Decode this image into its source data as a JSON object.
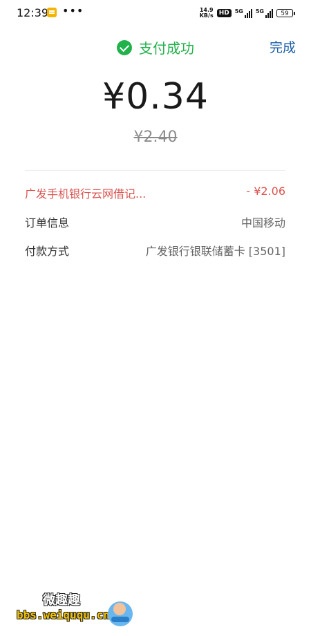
{
  "status_bar": {
    "time": "12:39",
    "dots": "•••",
    "net_speed_value": "14.9",
    "net_speed_unit": "KB/s",
    "hd": "HD",
    "sig1": "5G",
    "sig2": "5G",
    "battery": "59"
  },
  "header": {
    "status_text": "支付成功",
    "done_label": "完成"
  },
  "payment": {
    "amount": "¥0.34",
    "original_amount": "¥2.40"
  },
  "details": [
    {
      "label": "广发手机银行云网借记...",
      "value": "- ¥2.06"
    },
    {
      "label": "订单信息",
      "value": "中国移动"
    },
    {
      "label": "付款方式",
      "value": "广发银行银联储蓄卡 [3501]"
    }
  ],
  "watermark": {
    "top_text": "微趣趣",
    "bottom_text": "bbs.weiququ.cn"
  },
  "colors": {
    "success": "#22b24c",
    "link": "#1a5ea8",
    "discount": "#d9534f"
  }
}
